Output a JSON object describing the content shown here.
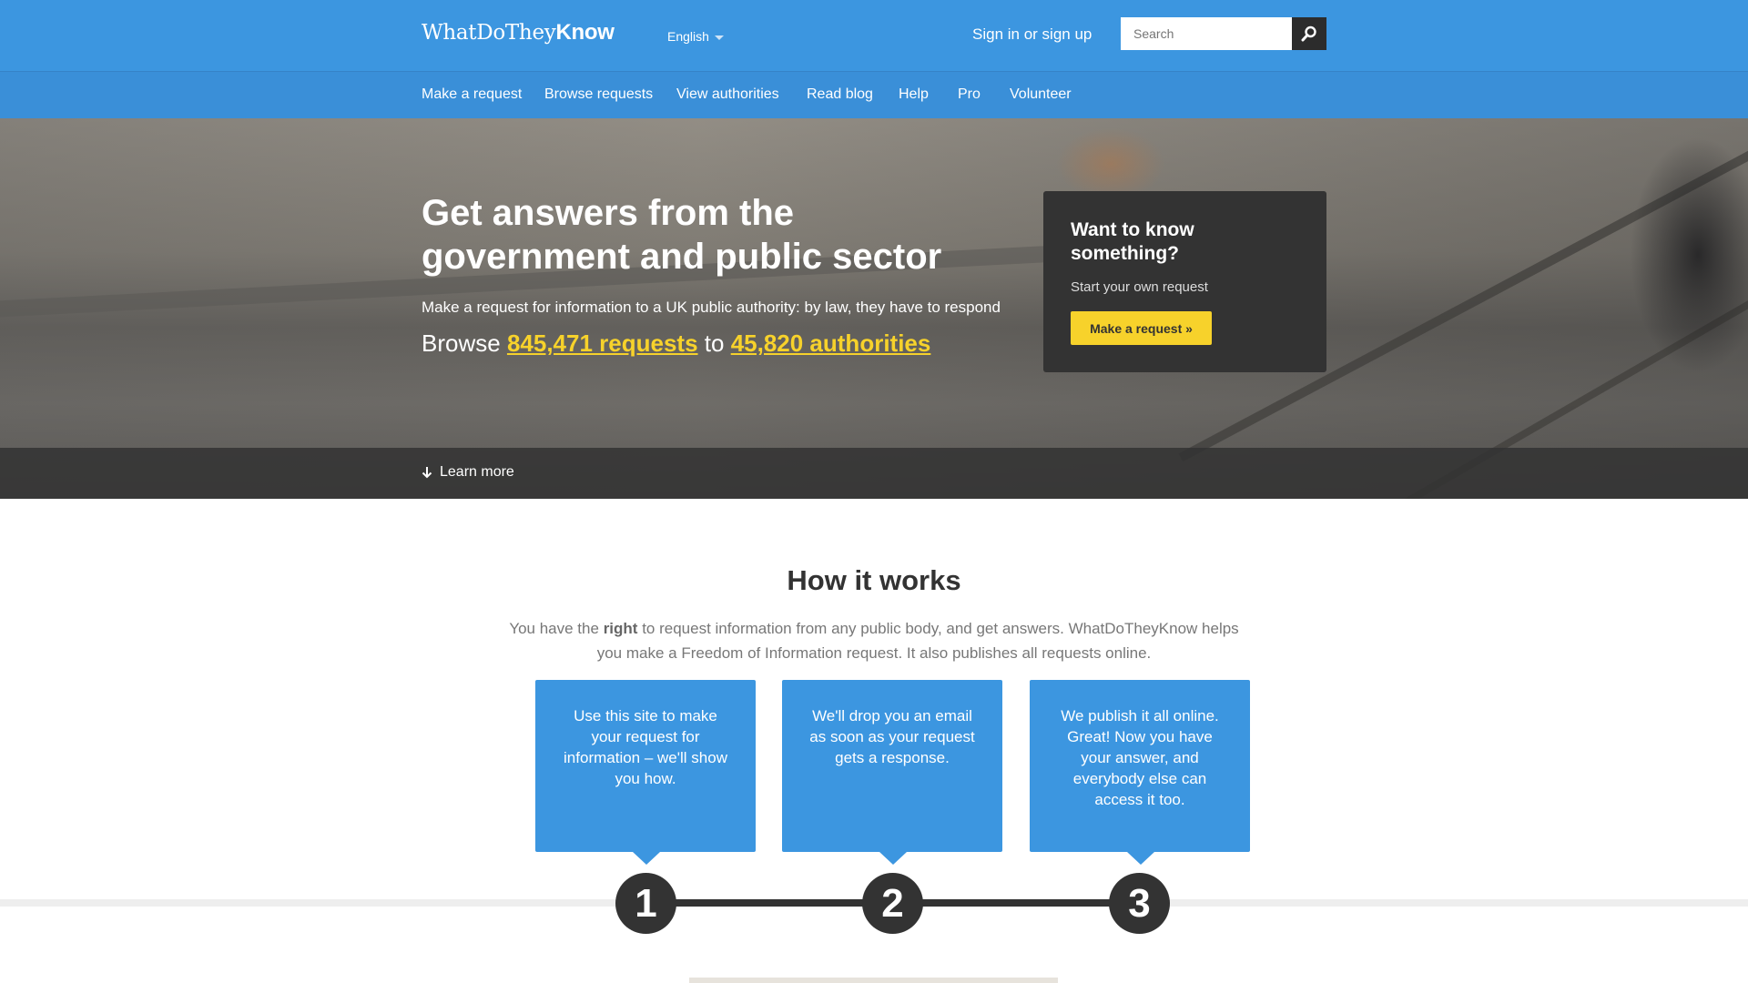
{
  "header": {
    "logo_regular": "WhatDoThey",
    "logo_bold": "Know",
    "language": "English",
    "signin": "Sign in or sign up",
    "search_placeholder": "Search",
    "brand_color": "#3c96e0"
  },
  "nav": {
    "items": [
      "Make a request",
      "Browse requests",
      "View authorities",
      "Read blog",
      "Help",
      "Pro",
      "Volunteer"
    ]
  },
  "hero": {
    "title": "Get answers from the government and public sector",
    "subtitle": "Make a request for information to a UK public authority: by law, they have to respond",
    "browse_prefix": "Browse",
    "requests_link": "845,471 requests",
    "browse_mid": "to",
    "authorities_link": "45,820 authorities",
    "learn_more": "Learn more",
    "accent_color": "#f7d22b"
  },
  "cta": {
    "title": "Want to know something?",
    "subtitle": "Start your own request",
    "button": "Make a request »"
  },
  "how": {
    "title": "How it works",
    "text_before": "You have the",
    "text_bold": "right",
    "text_after": "to request information from any public body, and get answers. WhatDoTheyKnow helps you make a Freedom of Information request. It also publishes all requests online.",
    "steps": [
      {
        "number": "1",
        "text": "Use this site to make your request for information – we'll show you how."
      },
      {
        "number": "2",
        "text": "We'll drop you an email as soon as your request gets a response."
      },
      {
        "number": "3",
        "text": "We publish it all online. Great! Now you have your answer, and everybody else can access it too."
      }
    ]
  },
  "icons": {
    "search": "search-icon",
    "arrow": "arrow-down-icon",
    "caret": "caret-down-icon"
  }
}
